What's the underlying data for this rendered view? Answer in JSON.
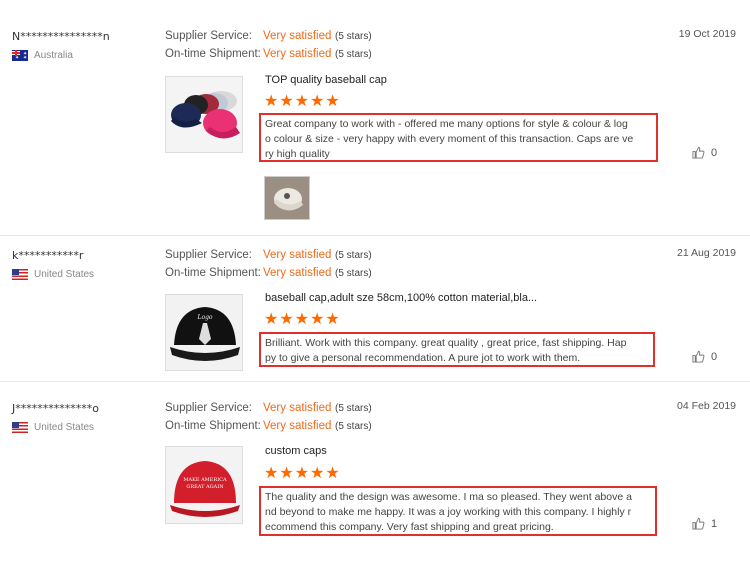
{
  "reviews": [
    {
      "buyer": "N***************n",
      "country": "Australia",
      "flag": "au",
      "supplier_service_label": "Supplier Service:",
      "supplier_service_value": "Very satisfied",
      "supplier_service_stars": "(5 stars)",
      "shipment_label": "On-time Shipment:",
      "shipment_value": "Very satisfied",
      "shipment_stars": "(5 stars)",
      "date": "19 Oct 2019",
      "product_title": "TOP quality baseball cap",
      "rating": 5,
      "feedback_lines": [
        "Great company to work with - offered me many options for style & colour & log",
        "o colour & size - very happy with every moment of this transaction. Caps are ve",
        "ry high quality"
      ],
      "helpful_count": "0",
      "thumb_image": "assorted-baseball-caps",
      "attachment": "white-cap-photo"
    },
    {
      "buyer": "k***********r",
      "country": "United States",
      "flag": "us",
      "supplier_service_label": "Supplier Service:",
      "supplier_service_value": "Very satisfied",
      "supplier_service_stars": "(5 stars)",
      "shipment_label": "On-time Shipment:",
      "shipment_value": "Very satisfied",
      "shipment_stars": "(5 stars)",
      "date": "21 Aug 2019",
      "product_title": "baseball cap,adult sze 58cm,100% cotton material,bla...",
      "rating": 5,
      "feedback_lines": [
        "Brilliant. Work with this company. great quality , great price, fast shipping. Hap",
        "py to give a personal recommendation. A pure jot to work with them."
      ],
      "helpful_count": "0",
      "thumb_image": "black-baseball-cap"
    },
    {
      "buyer": "J**************o",
      "country": "United States",
      "flag": "us",
      "supplier_service_label": "Supplier Service:",
      "supplier_service_value": "Very satisfied",
      "supplier_service_stars": "(5 stars)",
      "shipment_label": "On-time Shipment:",
      "shipment_value": "Very satisfied",
      "shipment_stars": "(5 stars)",
      "date": "04 Feb 2019",
      "product_title": "custom caps",
      "rating": 5,
      "feedback_lines": [
        "The quality and the design was awesome. I ma so  pleased. They went above a",
        "nd beyond to make me happy. It was a joy working with this company. I highly r",
        "ecommend this company. Very fast shipping and great pricing."
      ],
      "helpful_count": "1",
      "thumb_image": "red-cap",
      "thumb_text": [
        "MAKE AMERICA",
        "GREAT AGAIN"
      ]
    }
  ],
  "colors": {
    "accent": "#ee6a1a",
    "star": "#ff6a00",
    "highlight_border": "#e0302c"
  }
}
